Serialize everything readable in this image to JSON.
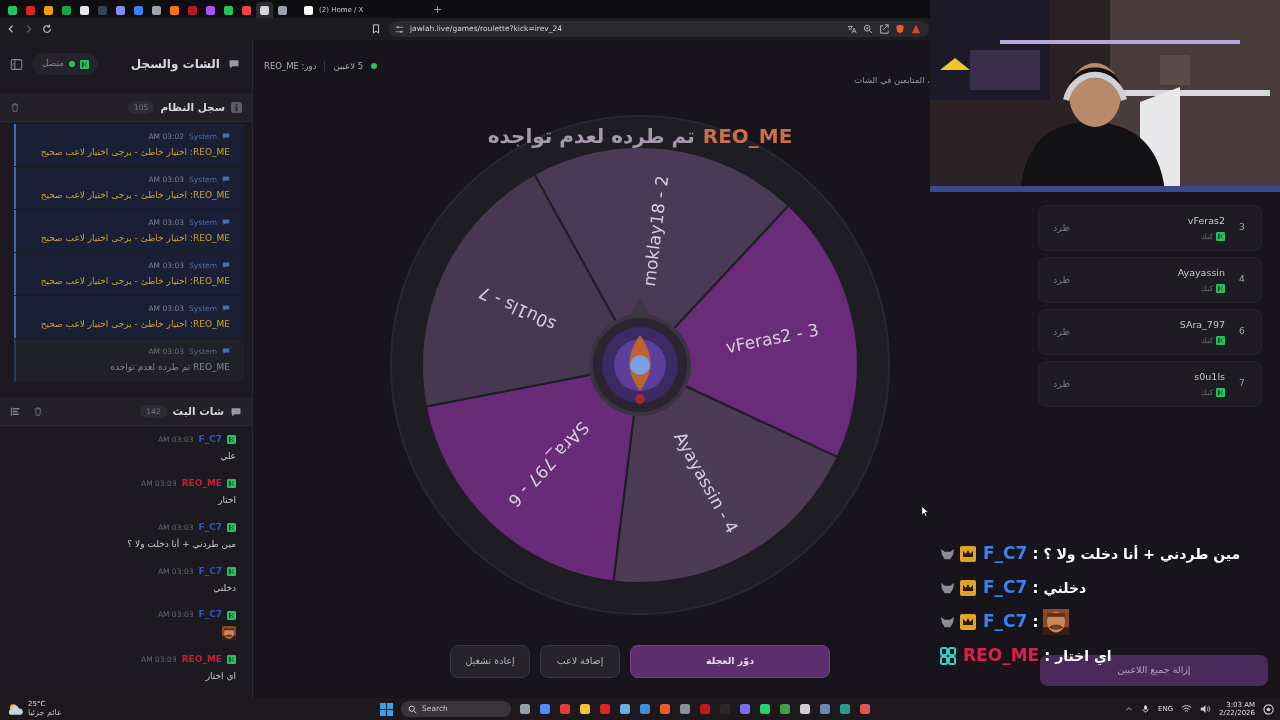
{
  "browser": {
    "tabs": [
      {
        "color": "#22c55e",
        "selected": false
      },
      {
        "color": "#dc2626",
        "selected": false
      },
      {
        "color": "#f59e0b",
        "selected": false
      },
      {
        "color": "#16a34a",
        "selected": false
      },
      {
        "color": "#e5e7eb",
        "selected": false
      },
      {
        "color": "#374151",
        "selected": false
      },
      {
        "color": "#818cf8",
        "selected": false
      },
      {
        "color": "#3b82f6",
        "selected": false
      },
      {
        "color": "#9ca3af",
        "selected": false
      },
      {
        "color": "#f97316",
        "selected": false
      },
      {
        "color": "#b91c1c",
        "selected": false
      },
      {
        "color": "#a855f7",
        "selected": false
      },
      {
        "color": "#22c55e",
        "selected": false
      },
      {
        "color": "#ef4444",
        "selected": false
      },
      {
        "color": "#d1d5db",
        "selected": true
      },
      {
        "color": "#9ca3af",
        "selected": false
      },
      {
        "color": "#ffffff",
        "selected": false,
        "label": "(2) Home / X"
      }
    ],
    "new_tab": "+",
    "url": "jawlah.live/games/roulette?kick=irev_24"
  },
  "sidebar": {
    "title": "الشات والسجل",
    "status": "متصل",
    "system_log": {
      "title": "سجل النظام",
      "count": "105",
      "entries": [
        {
          "kind": "error",
          "source": "System",
          "time": "AM 03:02",
          "message": "REO_ME: اختيار خاطئ - يرجى اختيار لاعب صحيح"
        },
        {
          "kind": "error",
          "source": "System",
          "time": "AM 03:03",
          "message": "REO_ME: اختيار خاطئ - يرجى اختيار لاعب صحيح"
        },
        {
          "kind": "error",
          "source": "System",
          "time": "AM 03:03",
          "message": "REO_ME: اختيار خاطئ - يرجى اختيار لاعب صحيح"
        },
        {
          "kind": "error",
          "source": "System",
          "time": "AM 03:03",
          "message": "REO_ME: اختيار خاطئ - يرجى اختيار لاعب صحيح"
        },
        {
          "kind": "error",
          "source": "System",
          "time": "AM 03:03",
          "message": "REO_ME: اختيار خاطئ - يرجى اختيار لاعب صحيح"
        },
        {
          "kind": "info",
          "source": "System",
          "time": "AM 03:03",
          "message": "REO_ME تم طرده لعدم تواجده"
        }
      ]
    },
    "stream_chat": {
      "title": "شات البث",
      "count": "142",
      "messages": [
        {
          "user": "F_C7",
          "color": "#3454c4",
          "time": "AM 03:03",
          "kind": "text",
          "text": "علي"
        },
        {
          "user": "REO_ME",
          "color": "#c0213a",
          "time": "AM 03:03",
          "kind": "text",
          "text": "اختار"
        },
        {
          "user": "F_C7",
          "color": "#3454c4",
          "time": "AM 03:03",
          "kind": "text",
          "text": "مين طردني + أنا دخلت ولا ؟"
        },
        {
          "user": "F_C7",
          "color": "#3454c4",
          "time": "AM 03:03",
          "kind": "text",
          "text": "دخلني"
        },
        {
          "user": "F_C7",
          "color": "#3454c4",
          "time": "AM 03:03",
          "kind": "emote"
        },
        {
          "user": "REO_ME",
          "color": "#c0213a",
          "time": "AM 03:03",
          "kind": "text",
          "text": "اي اختار"
        }
      ]
    }
  },
  "game": {
    "turn": "دور: REO_ME",
    "players_count": "5 لاعبين",
    "followers_note": "، المتابعين في الشات",
    "announcement": {
      "name": "REO_ME",
      "text": "تم طرده لعدم تواجده"
    },
    "wheel": {
      "segments": [
        {
          "label": "moklay18 - 2",
          "color": "#4b3a55"
        },
        {
          "label": "vFeras2 - 3",
          "color": "#692c78"
        },
        {
          "label": "Ayayassin - 4",
          "color": "#4d3b56"
        },
        {
          "label": "SAra_797 - 6",
          "color": "#672b77"
        },
        {
          "label": "s0u1ls - 7",
          "color": "#473851"
        }
      ]
    },
    "buttons": [
      {
        "label": "دوّر العجلة",
        "kind": "primary"
      },
      {
        "label": "إضافة لاعب",
        "kind": "secondary"
      },
      {
        "label": "إعادة تشغيل",
        "kind": "secondary"
      }
    ]
  },
  "players": {
    "items": [
      {
        "number": "3",
        "name": "vFeras2",
        "platform": "كيك",
        "action": "طرد"
      },
      {
        "number": "4",
        "name": "Ayayassin",
        "platform": "كيك",
        "action": "طرد"
      },
      {
        "number": "6",
        "name": "SAra_797",
        "platform": "كيك",
        "action": "طرد"
      },
      {
        "number": "7",
        "name": "s0u1ls",
        "platform": "كيك",
        "action": "طرد"
      }
    ],
    "remove_all": "إزالة جميع اللاعبين"
  },
  "overlay_chat": [
    {
      "badge": {
        "kind": "crown"
      },
      "user": "F_C7",
      "color": "#3b82f6",
      "separator": ":",
      "kind": "text",
      "text": "مين طردني + أنا دخلت ولا ؟"
    },
    {
      "badge": {
        "kind": "crown"
      },
      "user": "F_C7",
      "color": "#3b82f6",
      "separator": ":",
      "kind": "text",
      "text": "دخلني"
    },
    {
      "badge": {
        "kind": "crown"
      },
      "user": "F_C7",
      "color": "#3b82f6",
      "separator": ":",
      "kind": "emote"
    },
    {
      "badge": {
        "kind": "gg"
      },
      "user": "REO_ME",
      "color": "#e11d48",
      "separator": ":",
      "kind": "text",
      "text": "اي اختار"
    }
  ],
  "taskbar": {
    "temperature": "25°C",
    "weather": "غائم جزئيا",
    "search": "Search",
    "language": "ENG",
    "time": "3:03 AM",
    "date": "2/22/2026"
  }
}
